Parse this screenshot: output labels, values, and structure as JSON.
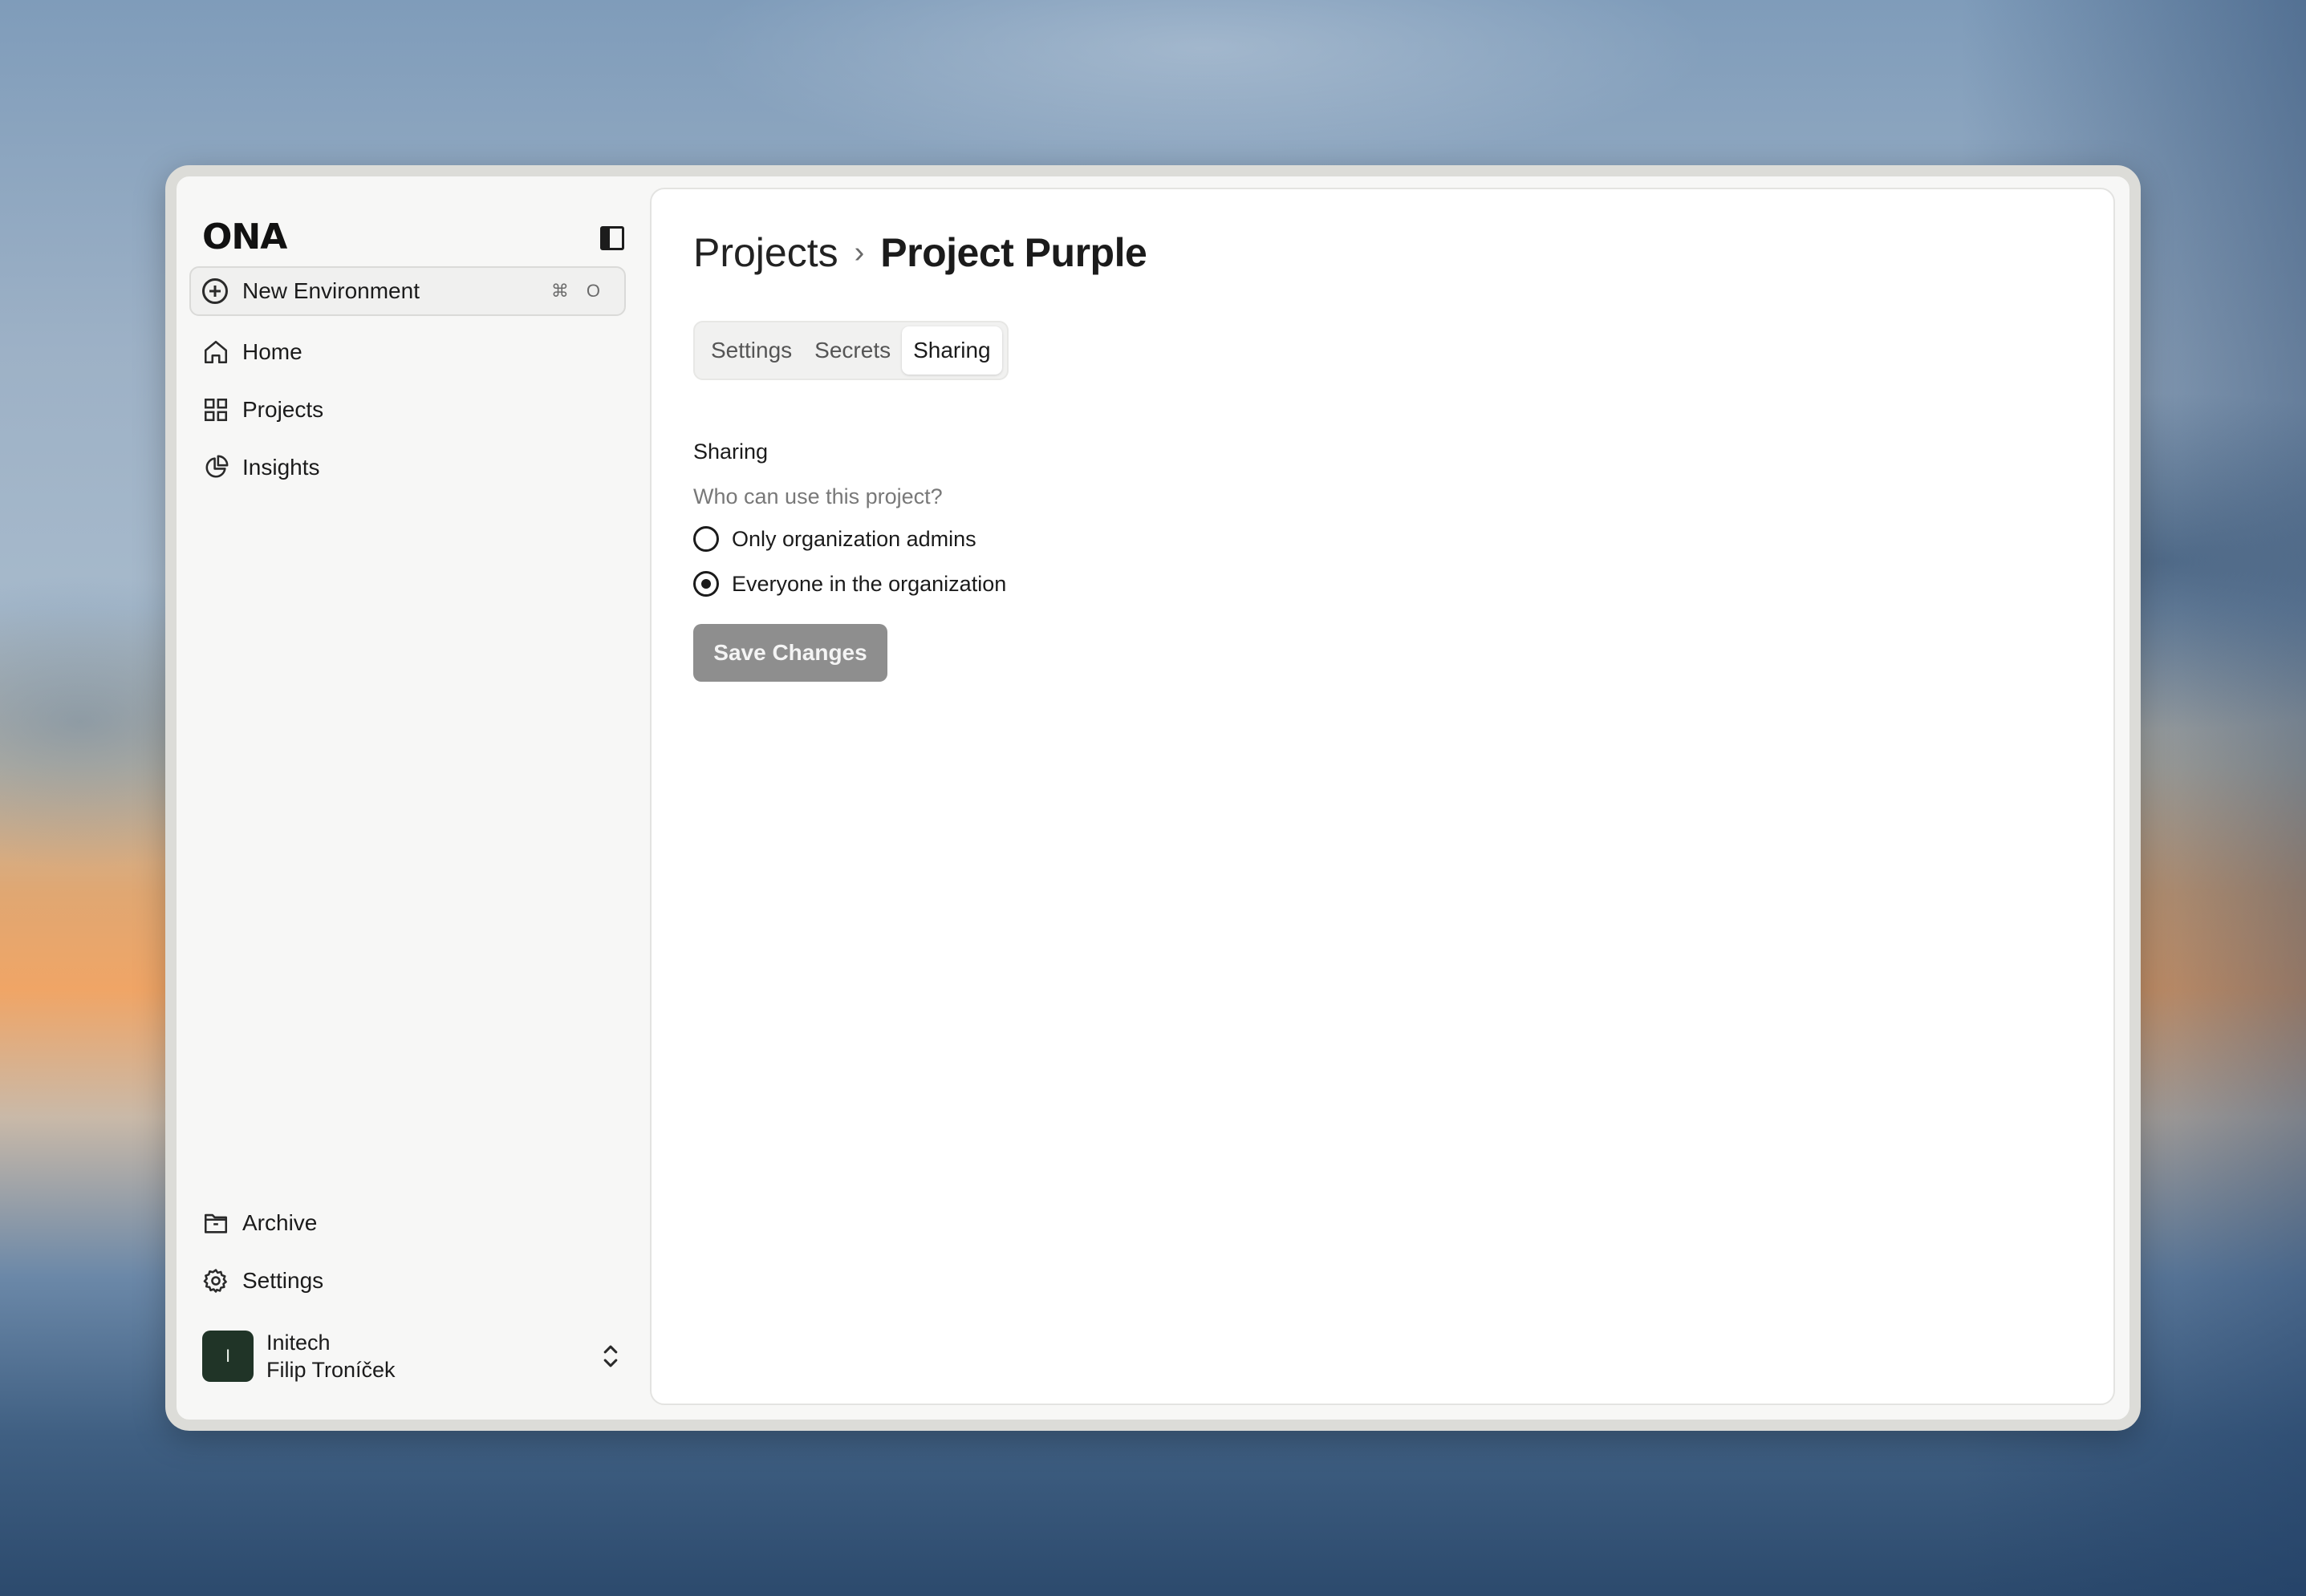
{
  "app": {
    "logo_text": "ONA"
  },
  "sidebar": {
    "new_env": {
      "label": "New Environment",
      "shortcut_key1": "⌘",
      "shortcut_key2": "O"
    },
    "items": [
      {
        "label": "Home",
        "icon": "home-icon"
      },
      {
        "label": "Projects",
        "icon": "grid-icon"
      },
      {
        "label": "Insights",
        "icon": "pie-chart-icon"
      }
    ],
    "bottom_items": [
      {
        "label": "Archive",
        "icon": "archive-folder-icon"
      },
      {
        "label": "Settings",
        "icon": "gear-icon"
      }
    ],
    "user": {
      "avatar_initial": "I",
      "org": "Initech",
      "name": "Filip Troníček"
    }
  },
  "main": {
    "breadcrumb": {
      "parent": "Projects",
      "separator": "›",
      "current": "Project Purple"
    },
    "tabs": [
      {
        "label": "Settings",
        "active": false
      },
      {
        "label": "Secrets",
        "active": false
      },
      {
        "label": "Sharing",
        "active": true
      }
    ],
    "sharing": {
      "title": "Sharing",
      "question": "Who can use this project?",
      "options": [
        {
          "label": "Only organization admins",
          "selected": false
        },
        {
          "label": "Everyone in the organization",
          "selected": true
        }
      ],
      "save_label": "Save Changes"
    }
  },
  "colors": {
    "avatar_bg": "#203427",
    "save_button_bg": "#8e8e8e",
    "window_bg": "#f7f7f6"
  }
}
